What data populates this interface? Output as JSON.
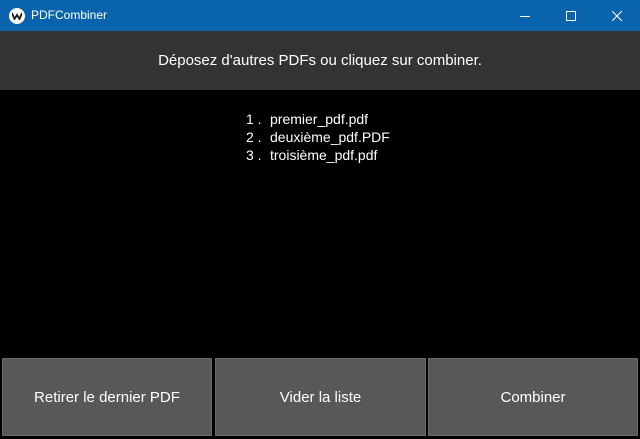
{
  "window": {
    "title": "PDFCombiner",
    "titlebar_color": "#0a64ad",
    "icon": "app-logo-icon"
  },
  "header": {
    "message": "Déposez d'autres PDFs ou cliquez sur combiner."
  },
  "files": [
    {
      "index": "1 .",
      "name": "premier_pdf.pdf"
    },
    {
      "index": "2 .",
      "name": "deuxième_pdf.PDF"
    },
    {
      "index": "3 .",
      "name": "troisième_pdf.pdf"
    }
  ],
  "buttons": {
    "remove_last": "Retirer le dernier PDF",
    "clear_list": "Vider la liste",
    "combine": "Combiner"
  }
}
